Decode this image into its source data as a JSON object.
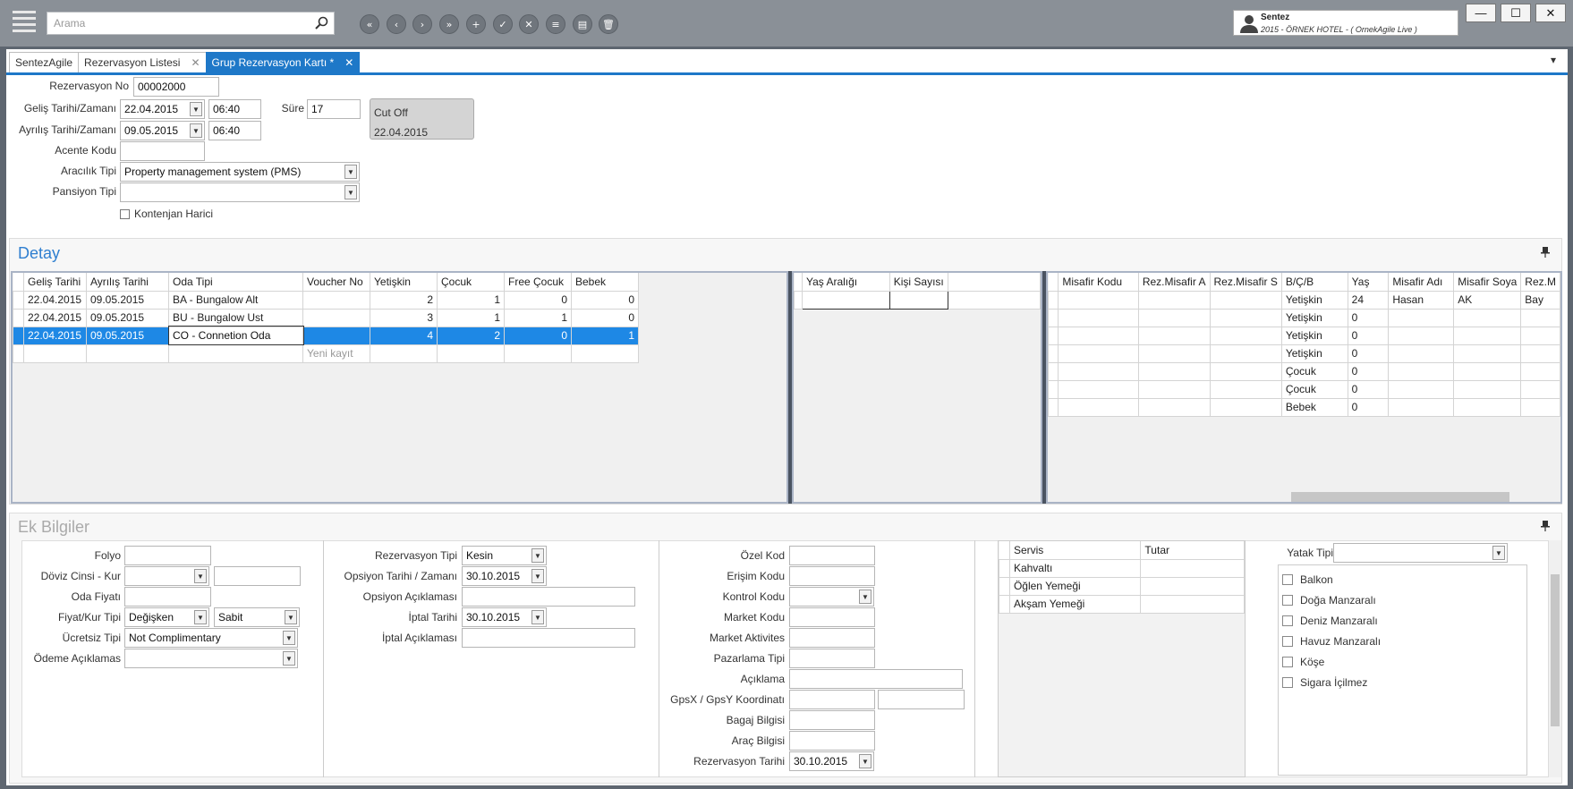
{
  "search": {
    "placeholder": "Arama"
  },
  "toolbar": [
    "«",
    "‹",
    "›",
    "»",
    "+",
    "✓",
    "✕",
    "≡",
    "▤",
    "🗑"
  ],
  "user": {
    "name": "Sentez",
    "subtitle": "2015 - ÖRNEK HOTEL - ( OrnekAgile Live )"
  },
  "window": {
    "minimize": "—",
    "maximize": "☐",
    "close": "✕"
  },
  "tabs": [
    {
      "label": "SentezAgile",
      "close": ""
    },
    {
      "label": "Rezervasyon Listesi",
      "close": "✕"
    },
    {
      "label": "Grup Rezervasyon Kartı *",
      "close": "✕"
    }
  ],
  "tab_menu": "▾",
  "header": {
    "rez_no_label": "Rezervasyon No",
    "rez_no": "00002000",
    "gelis_label": "Geliş Tarihi/Zamanı",
    "gelis_date": "22.04.2015",
    "gelis_time": "06:40",
    "ayrilis_label": "Ayrılış Tarihi/Zamanı",
    "ayrilis_date": "09.05.2015",
    "ayrilis_time": "06:40",
    "sure_label": "Süre",
    "sure": "17",
    "cutoff_label": "Cut Off",
    "cutoff_date": "22.04.2015",
    "acente_label": "Acente Kodu",
    "acente": "",
    "aracilik_label": "Aracılık Tipi",
    "aracilik": "Property management system (PMS)",
    "pansiyon_label": "Pansiyon Tipi",
    "pansiyon": "",
    "kontenjan_label": "Kontenjan Harici"
  },
  "detay": {
    "title": "Detay",
    "pin": "📌",
    "columns": [
      "Geliş Tarihi",
      "Ayrılış Tarihi",
      "Oda Tipi",
      "Voucher No",
      "Yetişkin",
      "Çocuk",
      "Free Çocuk",
      "Bebek"
    ],
    "rows": [
      [
        "22.04.2015",
        "09.05.2015",
        "BA - Bungalow Alt",
        "",
        "2",
        "1",
        "0",
        "0"
      ],
      [
        "22.04.2015",
        "09.05.2015",
        "BU - Bungalow Ust",
        "",
        "3",
        "1",
        "1",
        "0"
      ],
      [
        "22.04.2015",
        "09.05.2015",
        "CO - Connetion Oda",
        "",
        "4",
        "2",
        "0",
        "1"
      ]
    ],
    "new_row": "Yeni kayıt",
    "age_columns": [
      "Yaş Aralığı",
      "Kişi Sayısı"
    ],
    "guest_columns": [
      "Misafir Kodu",
      "Rez.Misafir A",
      "Rez.Misafir S",
      "B/Ç/B",
      "Yaş",
      "Misafir Adı",
      "Misafir Soya",
      "Rez.M"
    ],
    "guest_rows": [
      [
        "",
        "",
        "",
        "Yetişkin",
        "24",
        "Hasan",
        "AK",
        "Bay"
      ],
      [
        "",
        "",
        "",
        "Yetişkin",
        "0",
        "",
        "",
        ""
      ],
      [
        "",
        "",
        "",
        "Yetişkin",
        "0",
        "",
        "",
        ""
      ],
      [
        "",
        "",
        "",
        "Yetişkin",
        "0",
        "",
        "",
        ""
      ],
      [
        "",
        "",
        "",
        "Çocuk",
        "0",
        "",
        "",
        ""
      ],
      [
        "",
        "",
        "",
        "Çocuk",
        "0",
        "",
        "",
        ""
      ],
      [
        "",
        "",
        "",
        "Bebek",
        "0",
        "",
        "",
        ""
      ]
    ]
  },
  "ek": {
    "title": "Ek Bilgiler",
    "col1": {
      "folyo_label": "Folyo",
      "folyo": "",
      "doviz_label": "Döviz Cinsi - Kur",
      "doviz": "",
      "kur": "",
      "oda_fiyati_label": "Oda Fiyatı",
      "oda_fiyati": "",
      "fiyat_kur_label": "Fiyat/Kur Tipi",
      "fiyat_tipi": "Değişken",
      "kur_tipi": "Sabit",
      "ucretsiz_label": "Ücretsiz Tipi",
      "ucretsiz": "Not Complimentary",
      "odeme_label": "Ödeme Açıklamas",
      "odeme": ""
    },
    "col2": {
      "rez_tipi_label": "Rezervasyon Tipi",
      "rez_tipi": "Kesin",
      "opsiyon_label": "Opsiyon Tarihi /  Zamanı",
      "opsiyon": "30.10.2015",
      "opsiyon_acik_label": "Opsiyon Açıklaması",
      "opsiyon_acik": "",
      "iptal_label": "İptal Tarihi",
      "iptal": "30.10.2015",
      "iptal_acik_label": "İptal Açıklaması",
      "iptal_acik": ""
    },
    "col3": {
      "ozel_kod_label": "Özel Kod",
      "erisim_label": "Erişim Kodu",
      "kontrol_label": "Kontrol Kodu",
      "market_kodu_label": "Market Kodu",
      "market_akt_label": "Market Aktivites",
      "pazarlama_label": "Pazarlama Tipi",
      "aciklama_label": "Açıklama",
      "gps_label": "GpsX / GpsY Koordinatı",
      "bagaj_label": "Bagaj Bilgisi",
      "arac_label": "Araç Bilgisi",
      "rez_tarihi_label": "Rezervasyon Tarihi",
      "rez_tarihi": "30.10.2015"
    },
    "servis": {
      "columns": [
        "Servis",
        "Tutar"
      ],
      "rows": [
        [
          "Kahvaltı",
          ""
        ],
        [
          "Öğlen Yemeği",
          ""
        ],
        [
          "Akşam Yemeği",
          ""
        ]
      ]
    },
    "yatak": {
      "label": "Yatak Tipi",
      "value": "",
      "options": [
        "Balkon",
        "Doğa Manzaralı",
        "Deniz Manzaralı",
        "Havuz Manzaralı",
        "Köşe",
        "Sigara İçilmez"
      ]
    }
  }
}
